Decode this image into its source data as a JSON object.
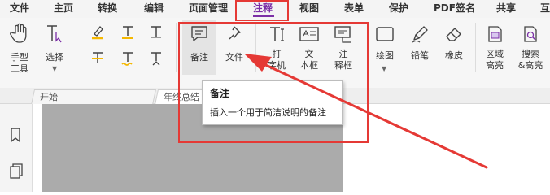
{
  "menu": {
    "items": [
      "文件",
      "主页",
      "转换",
      "编辑",
      "页面管理",
      "注释",
      "视图",
      "表单",
      "保护",
      "PDF签名",
      "共享",
      "互"
    ],
    "active": "注释"
  },
  "toolbar": {
    "hand_tool": "手型\n工具",
    "select_tool": "选择",
    "note": "备注",
    "file": "文件",
    "typewriter": "打\n字机",
    "textbox": "文\n本框",
    "callout": "注\n释框",
    "drawing": "绘图",
    "pencil": "铅笔",
    "eraser": "橡皮",
    "area_highlight": "区域\n高亮",
    "search_highlight": "搜索\n&高亮"
  },
  "tabs": [
    "开始",
    "年终总结"
  ],
  "tooltip": {
    "title": "备注",
    "description": "插入一个用于简洁说明的备注"
  },
  "colors": {
    "accent": "#7b2fa6",
    "annotation_red": "#e53935",
    "page_gray": "#ababab"
  }
}
